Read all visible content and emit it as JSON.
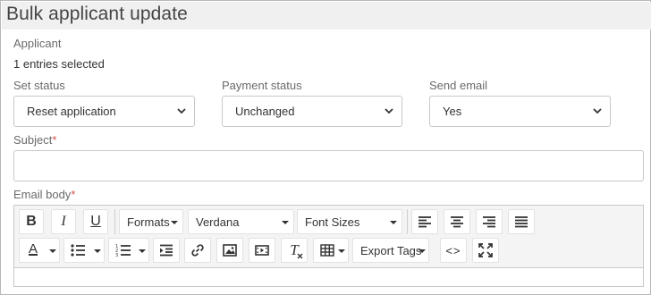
{
  "dialog": {
    "title": "Bulk applicant update"
  },
  "applicant": {
    "label": "Applicant",
    "summary": "1 entries selected"
  },
  "set_status": {
    "label": "Set status",
    "value": "Reset application"
  },
  "payment_status": {
    "label": "Payment status",
    "value": "Unchanged"
  },
  "send_email": {
    "label": "Send email",
    "value": "Yes"
  },
  "subject": {
    "label": "Subject",
    "required_mark": "*",
    "value": ""
  },
  "email_body": {
    "label": "Email body",
    "required_mark": "*"
  },
  "toolbar": {
    "bold": "B",
    "italic": "I",
    "underline": "U",
    "formats": "Formats",
    "font_family": "Verdana",
    "font_sizes": "Font Sizes",
    "text_color": "A",
    "clear_format": "T",
    "export_tags": "Export Tags",
    "source_code": "<>"
  },
  "colors": {
    "title_bar": "#f0f0f0",
    "required": "#d9534f",
    "toolbar_bg": "#f4f4f4",
    "border": "#c8c8c8"
  }
}
